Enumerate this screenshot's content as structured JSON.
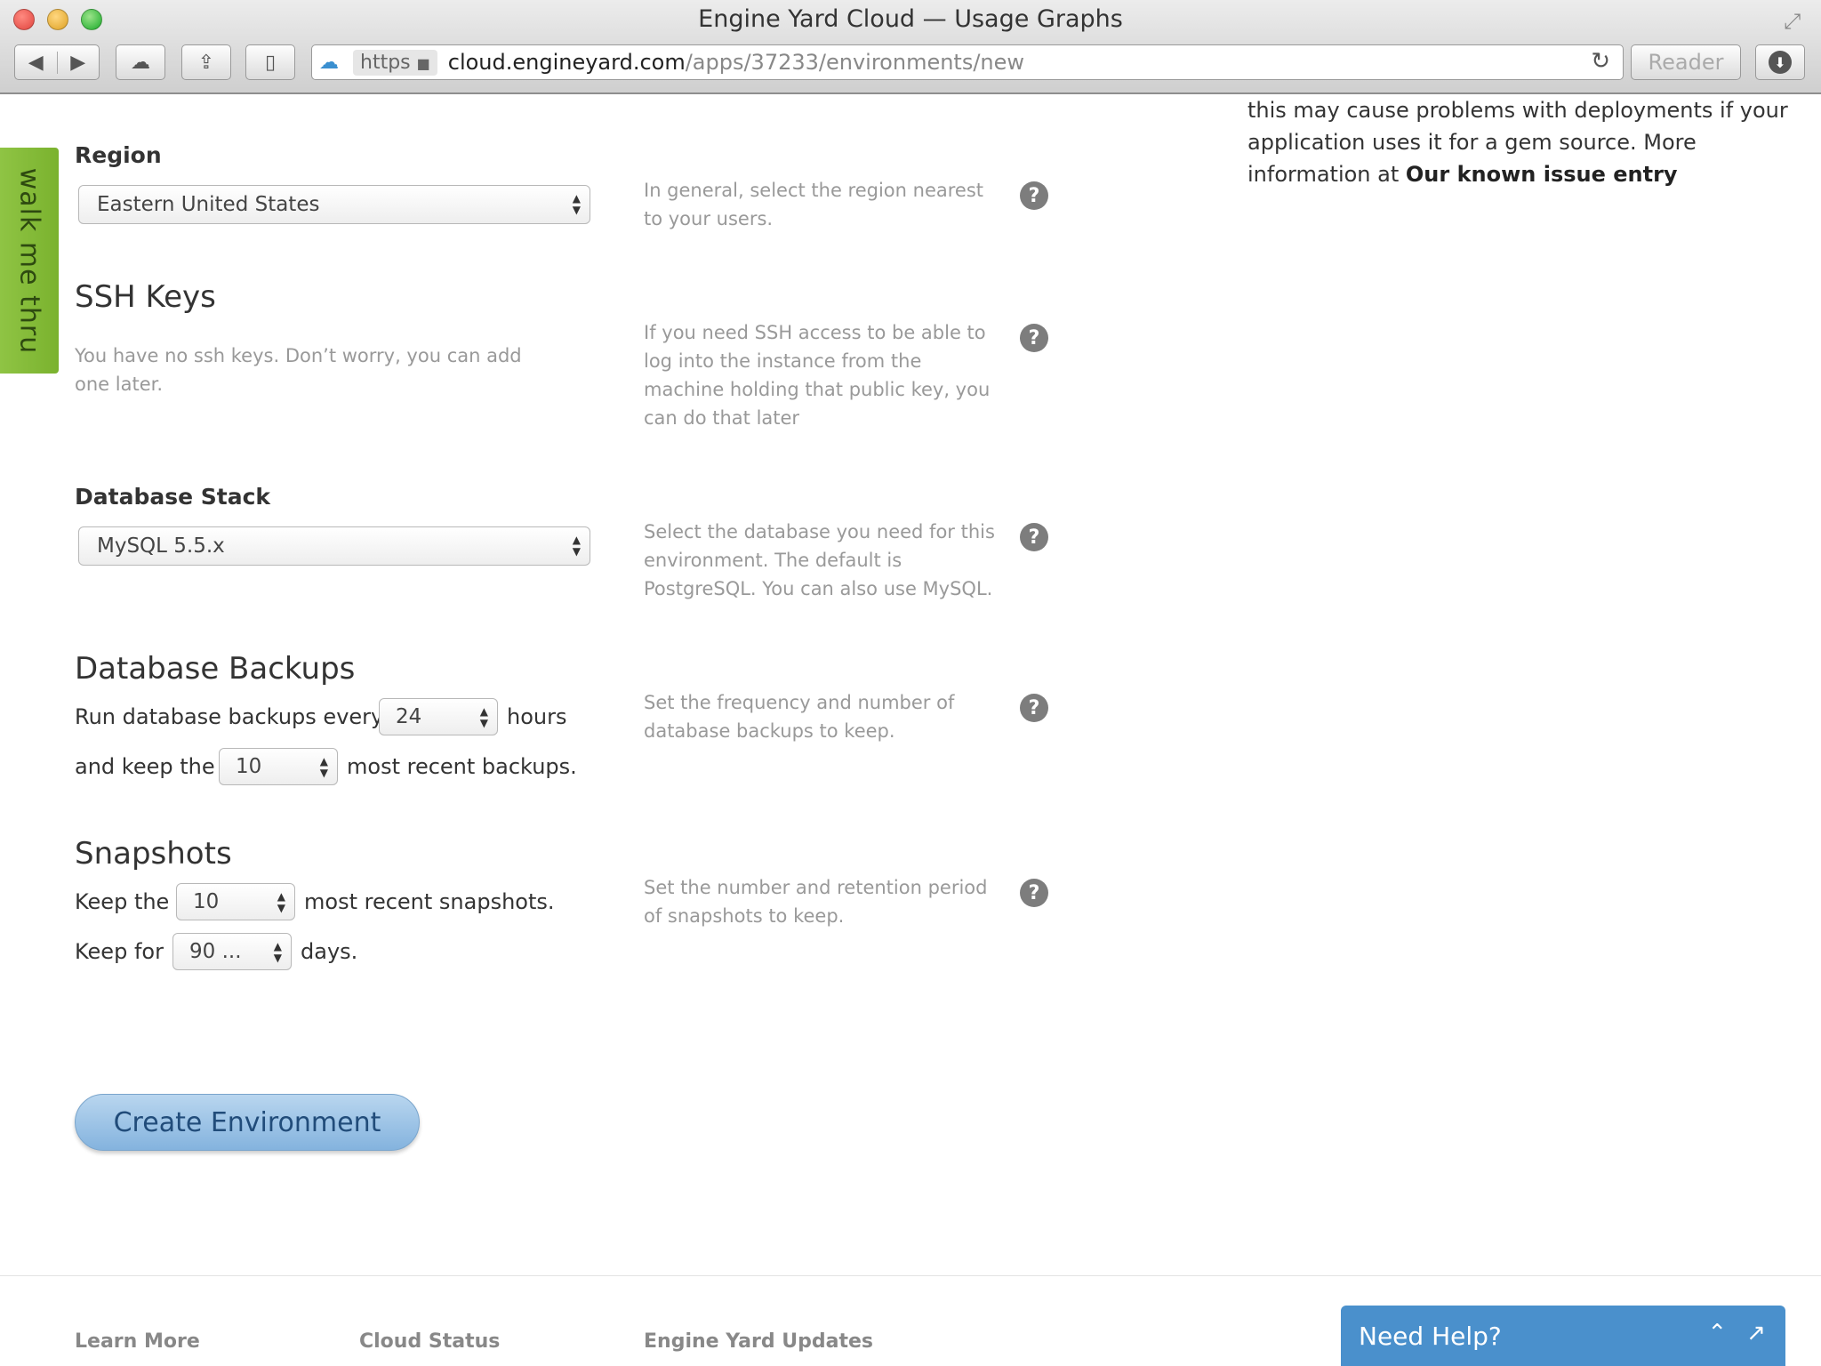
{
  "window": {
    "title": "Engine Yard Cloud — Usage Graphs"
  },
  "toolbar": {
    "back_icon": "◀",
    "forward_icon": "▶",
    "cloud_icon": "☁",
    "share_icon": "⇪",
    "sidebar_icon": "▯",
    "reader_label": "Reader",
    "download_icon": "⬇",
    "reload_icon": "↻"
  },
  "urlbar": {
    "scheme": "https",
    "lock_icon": "🔒",
    "host": "cloud.engineyard.com",
    "path": "/apps/37233/environments/new"
  },
  "walkme": {
    "label": "walk me thru"
  },
  "form": {
    "region": {
      "label": "Region",
      "selected": "Eastern United States",
      "help": "In general, select the region nearest to your users."
    },
    "ssh": {
      "heading": "SSH Keys",
      "note": "You have no ssh keys. Don’t worry, you can add one later.",
      "help": "If you need SSH access to be able to log into the instance from the machine holding that public key, you can do that later"
    },
    "database_stack": {
      "label": "Database Stack",
      "selected": "MySQL 5.5.x",
      "help": "Select the database you need for this environment. The default is PostgreSQL. You can also use MySQL."
    },
    "backups": {
      "heading": "Database Backups",
      "run_prefix": "Run database backups every",
      "frequency": "24",
      "run_suffix": "hours",
      "keep_prefix": "and keep the",
      "count": "10",
      "keep_suffix": "most recent backups.",
      "help": "Set the frequency and number of database backups to keep."
    },
    "snapshots": {
      "heading": "Snapshots",
      "keep_prefix": "Keep the",
      "count": "10",
      "keep_suffix": "most recent snapshots.",
      "for_prefix": "Keep for",
      "days": "90 ...",
      "for_suffix": "days.",
      "help": "Set the number and retention period of snapshots to keep."
    },
    "submit_label": "Create Environment",
    "help_glyph": "?"
  },
  "notice": {
    "text": "this may cause problems with deployments if your application uses it for a gem source. More information at",
    "link": "Our known issue entry"
  },
  "footer": {
    "links": [
      "Learn More",
      "Cloud Status",
      "Engine Yard Updates"
    ]
  },
  "help_widget": {
    "label": "Need Help?",
    "collapse_icon": "⌃",
    "popout_icon": "↗"
  },
  "colors": {
    "walkme_green": "#8fc444",
    "button_blue": "#84b3de",
    "help_widget_blue": "#4a90cc"
  }
}
